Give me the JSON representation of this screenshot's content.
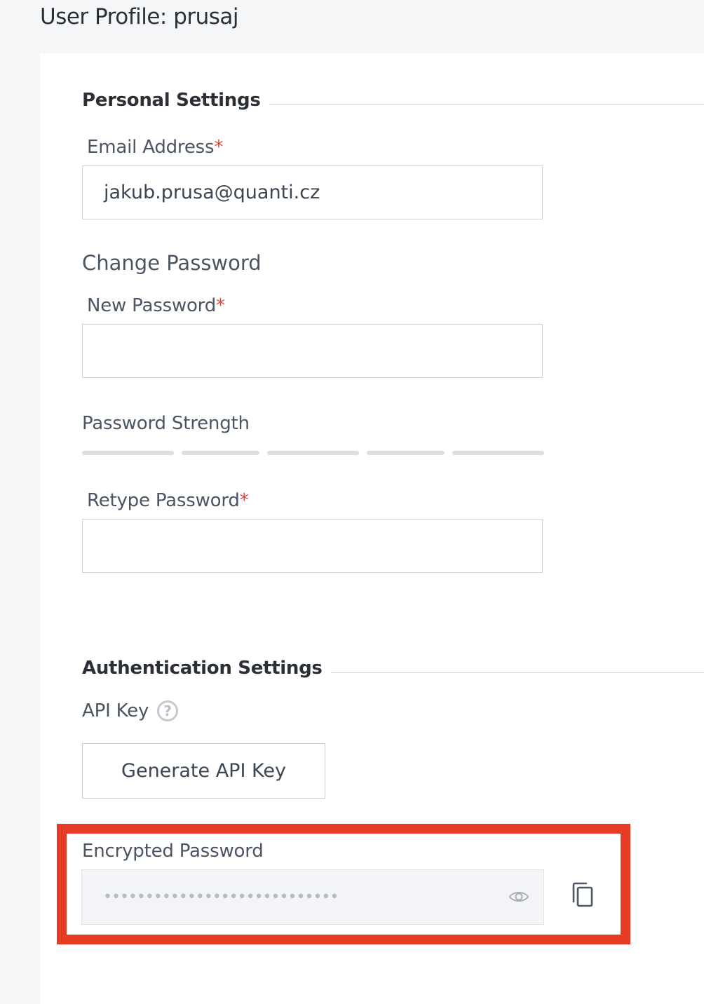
{
  "page": {
    "title": "User Profile: prusaj"
  },
  "personal_settings": {
    "title": "Personal Settings",
    "email": {
      "label": "Email Address",
      "required_mark": "*",
      "value": "jakub.prusa@quanti.cz"
    },
    "change_password": {
      "title": "Change Password",
      "new_password": {
        "label": "New Password",
        "required_mark": "*",
        "value": ""
      },
      "strength": {
        "label": "Password Strength",
        "segments": 5,
        "filled": 0
      },
      "retype_password": {
        "label": "Retype Password",
        "required_mark": "*",
        "value": ""
      }
    }
  },
  "authentication_settings": {
    "title": "Authentication Settings",
    "api_key": {
      "label": "API Key",
      "help_icon": "question-circle-icon",
      "help_glyph": "?",
      "generate_button": "Generate API Key"
    },
    "encrypted_password": {
      "label": "Encrypted Password",
      "masked_value": "••••••••••••••••••••••••••••",
      "reveal_icon": "eye-icon",
      "copy_icon": "copy-icon"
    }
  },
  "colors": {
    "required": "#e0453a",
    "highlight": "#e63b24",
    "page_background": "#f5f6f8"
  }
}
